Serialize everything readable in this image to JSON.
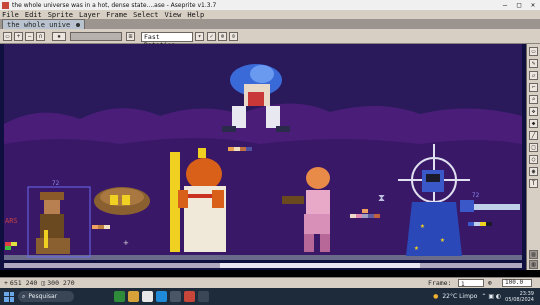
{
  "window": {
    "title": "the whole universe was in a hot, dense state....ase - Aseprite v1.3.7",
    "minimize": "–",
    "maximize": "□",
    "close": "✕"
  },
  "menu": [
    "File",
    "Edit",
    "Sprite",
    "Layer",
    "Frame",
    "Select",
    "View",
    "Help"
  ],
  "tabs": [
    {
      "label": "the whole unive"
    }
  ],
  "toolbar": {
    "rotation_option": "Fast Rotation"
  },
  "canvas": {
    "background_colors": [
      "#101040",
      "#2a1a5c",
      "#4a1e78"
    ],
    "sprite_labels": [
      "ARS",
      "72",
      "72"
    ]
  },
  "tools": [
    "marquee-icon",
    "pencil-icon",
    "eraser-icon",
    "eyedropper-icon",
    "zoom-icon",
    "move-icon",
    "paint-bucket-icon",
    "line-icon",
    "rectangle-icon",
    "ellipse-icon",
    "blur-icon",
    "text-icon"
  ],
  "status": {
    "position": "651 240",
    "size": "300 270",
    "frame_label": "Frame:",
    "frame_value": "1",
    "zoom_value": "100.0"
  },
  "taskbar": {
    "search_placeholder": "Pesquisar",
    "weather": "22°C  Limpo",
    "time": "23:39",
    "date": "05/08/2024"
  }
}
